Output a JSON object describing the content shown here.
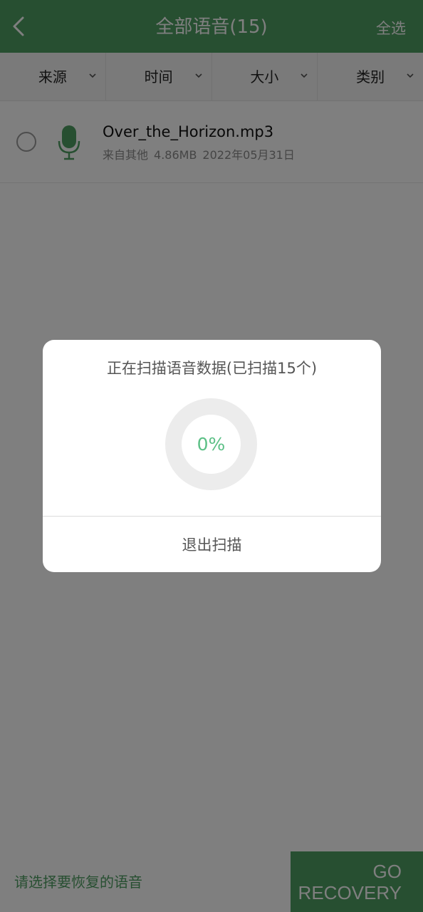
{
  "topbar": {
    "title": "全部语音(15)",
    "select_all": "全选",
    "back_icon": "chevron-left-icon",
    "color": "#4f9e63"
  },
  "filters": [
    {
      "label": "来源"
    },
    {
      "label": "时间"
    },
    {
      "label": "大小"
    },
    {
      "label": "类别"
    }
  ],
  "files": [
    {
      "name": "Over_the_Horizon.mp3",
      "source": "来自其他",
      "size": "4.86MB",
      "date": "2022年05月31日",
      "selected": false,
      "icon": "microphone-icon"
    }
  ],
  "bottom": {
    "hint": "请选择要恢复的语音",
    "go_line1": "GO",
    "go_line2": "RECOVERY"
  },
  "dialog": {
    "title": "正在扫描语音数据(已扫描15个)",
    "progress_text": "0%",
    "progress_fraction": 0,
    "exit_label": "退出扫描",
    "accent": "#5cc086"
  }
}
